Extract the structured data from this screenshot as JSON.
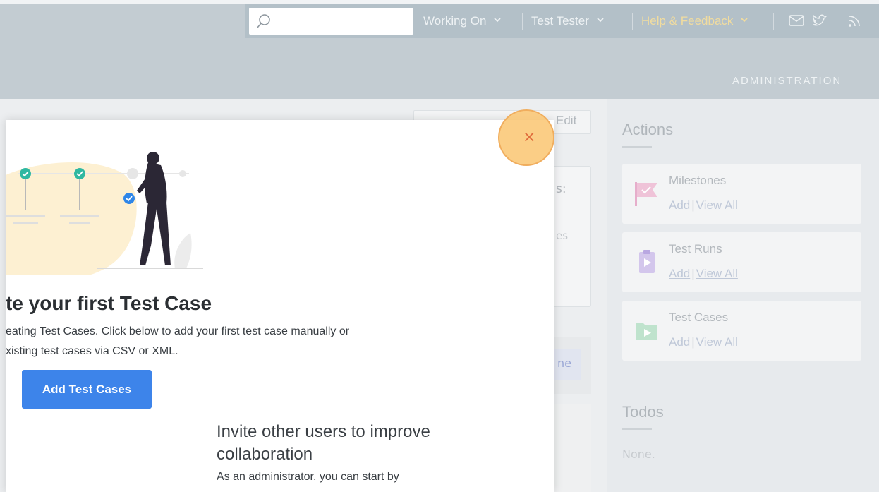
{
  "header": {
    "search": {
      "value": "",
      "placeholder": ""
    },
    "nav": {
      "working_on": "Working On",
      "user": "Test Tester",
      "help": "Help & Feedback"
    },
    "admin_link": "ADMINISTRATION"
  },
  "main": {
    "toolbar_edit_label": "Edit",
    "card_colon_fragment": "s:",
    "card_text_fragment": "es",
    "panel_link_fragment": "ne"
  },
  "sidebar": {
    "actions_heading": "Actions",
    "actions": [
      {
        "title": "Milestones",
        "add": "Add",
        "view_all": "View All"
      },
      {
        "title": "Test Runs",
        "add": "Add",
        "view_all": "View All"
      },
      {
        "title": "Test Cases",
        "add": "Add",
        "view_all": "View All"
      }
    ],
    "todos_heading": "Todos",
    "todos_none": "None."
  },
  "modal": {
    "close_symbol": "×",
    "title": "te your first Test Case",
    "description_line1": "eating Test Cases. Click below to add your first test case manually or",
    "description_line2": "xisting test cases via CSV or XML.",
    "primary_button": "Add Test Cases",
    "invite_title": "Invite other users to improve collaboration",
    "invite_desc": "As an administrator, you can start by"
  },
  "colors": {
    "primary": "#3d84ea",
    "highlight": "#fac571",
    "help_link": "#f1dc9f"
  }
}
